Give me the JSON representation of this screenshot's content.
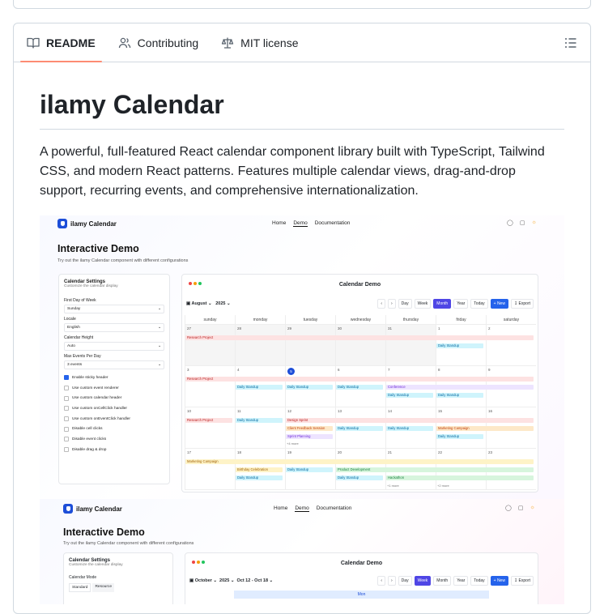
{
  "tabs": [
    {
      "label": "README",
      "icon": "book-icon"
    },
    {
      "label": "Contributing",
      "icon": "people-icon"
    },
    {
      "label": "MIT license",
      "icon": "law-icon"
    }
  ],
  "readme": {
    "title": "ilamy Calendar",
    "description": "A powerful, full-featured React calendar component library built with TypeScript, Tailwind CSS, and modern React patterns. Features multiple calendar views, drag-and-drop support, recurring events, and comprehensive internationalization."
  },
  "demo": {
    "brand": "ilamy Calendar",
    "nav": [
      "Home",
      "Demo",
      "Documentation"
    ],
    "heading": "Interactive Demo",
    "subheading": "Try out the ilamy Calendar component with different configurations",
    "settings": {
      "title": "Calendar Settings",
      "subtitle": "Customize the calendar display",
      "first_day_label": "First Day of Week",
      "first_day_value": "Sunday",
      "locale_label": "Locale",
      "locale_value": "English",
      "height_label": "Calendar Height",
      "height_value": "Auto",
      "max_events_label": "Max Events Per Day",
      "max_events_value": "3 events",
      "checkboxes": [
        {
          "label": "Enable sticky header",
          "checked": true
        },
        {
          "label": "Use custom event renderer",
          "checked": false
        },
        {
          "label": "Use custom calendar header",
          "checked": false
        },
        {
          "label": "Use custom onCellClick handler",
          "checked": false
        },
        {
          "label": "Use custom onEventClick handler",
          "checked": false
        },
        {
          "label": "Disable cell clicks",
          "checked": false
        },
        {
          "label": "Disable event clicks",
          "checked": false
        },
        {
          "label": "Disable drag & drop",
          "checked": false
        }
      ]
    },
    "calendar": {
      "title": "Calendar Demo",
      "month": "August",
      "year": "2025",
      "views": [
        "Day",
        "Week",
        "Month",
        "Year",
        "Today"
      ],
      "active_view": "Month",
      "new_label": "+ New",
      "export_label": "Export",
      "days": [
        "sunday",
        "monday",
        "tuesday",
        "wednesday",
        "thursday",
        "friday",
        "saturday"
      ],
      "weeks": [
        [
          "27",
          "28",
          "29",
          "30",
          "31",
          "1",
          "2"
        ],
        [
          "3",
          "4",
          "5",
          "6",
          "7",
          "8",
          "9"
        ],
        [
          "10",
          "11",
          "12",
          "13",
          "14",
          "15",
          "16"
        ],
        [
          "17",
          "18",
          "19",
          "20",
          "21",
          "22",
          "23"
        ]
      ],
      "events": {
        "research_project": "Research Project",
        "daily_standup": "Daily Standup",
        "conference": "Conference",
        "design_sprint": "Design Sprint",
        "client_feedback": "Client Feedback Session",
        "marketing": "Marketing Campaign",
        "sprint_planning": "Sprint Planning",
        "birthday": "Birthday Celebration",
        "product_dev": "Product Development",
        "hackathon": "Hackathon",
        "more": "+4 more",
        "more1": "+1 more",
        "more2": "+2 more"
      }
    },
    "second": {
      "brand": "ilamy Calendar",
      "heading": "Interactive Demo",
      "subheading": "Try out the ilamy Calendar component with different configurations",
      "settings_title": "Calendar Settings",
      "settings_subtitle": "Customize the calendar display",
      "mode_label": "Calendar Mode",
      "mode_options": [
        "Standard",
        "Resource"
      ],
      "cal_title": "Calendar Demo",
      "month": "October",
      "year": "2025",
      "range": "Oct 12 - Oct 18",
      "active_view": "Week",
      "day_label": "Mon"
    }
  }
}
